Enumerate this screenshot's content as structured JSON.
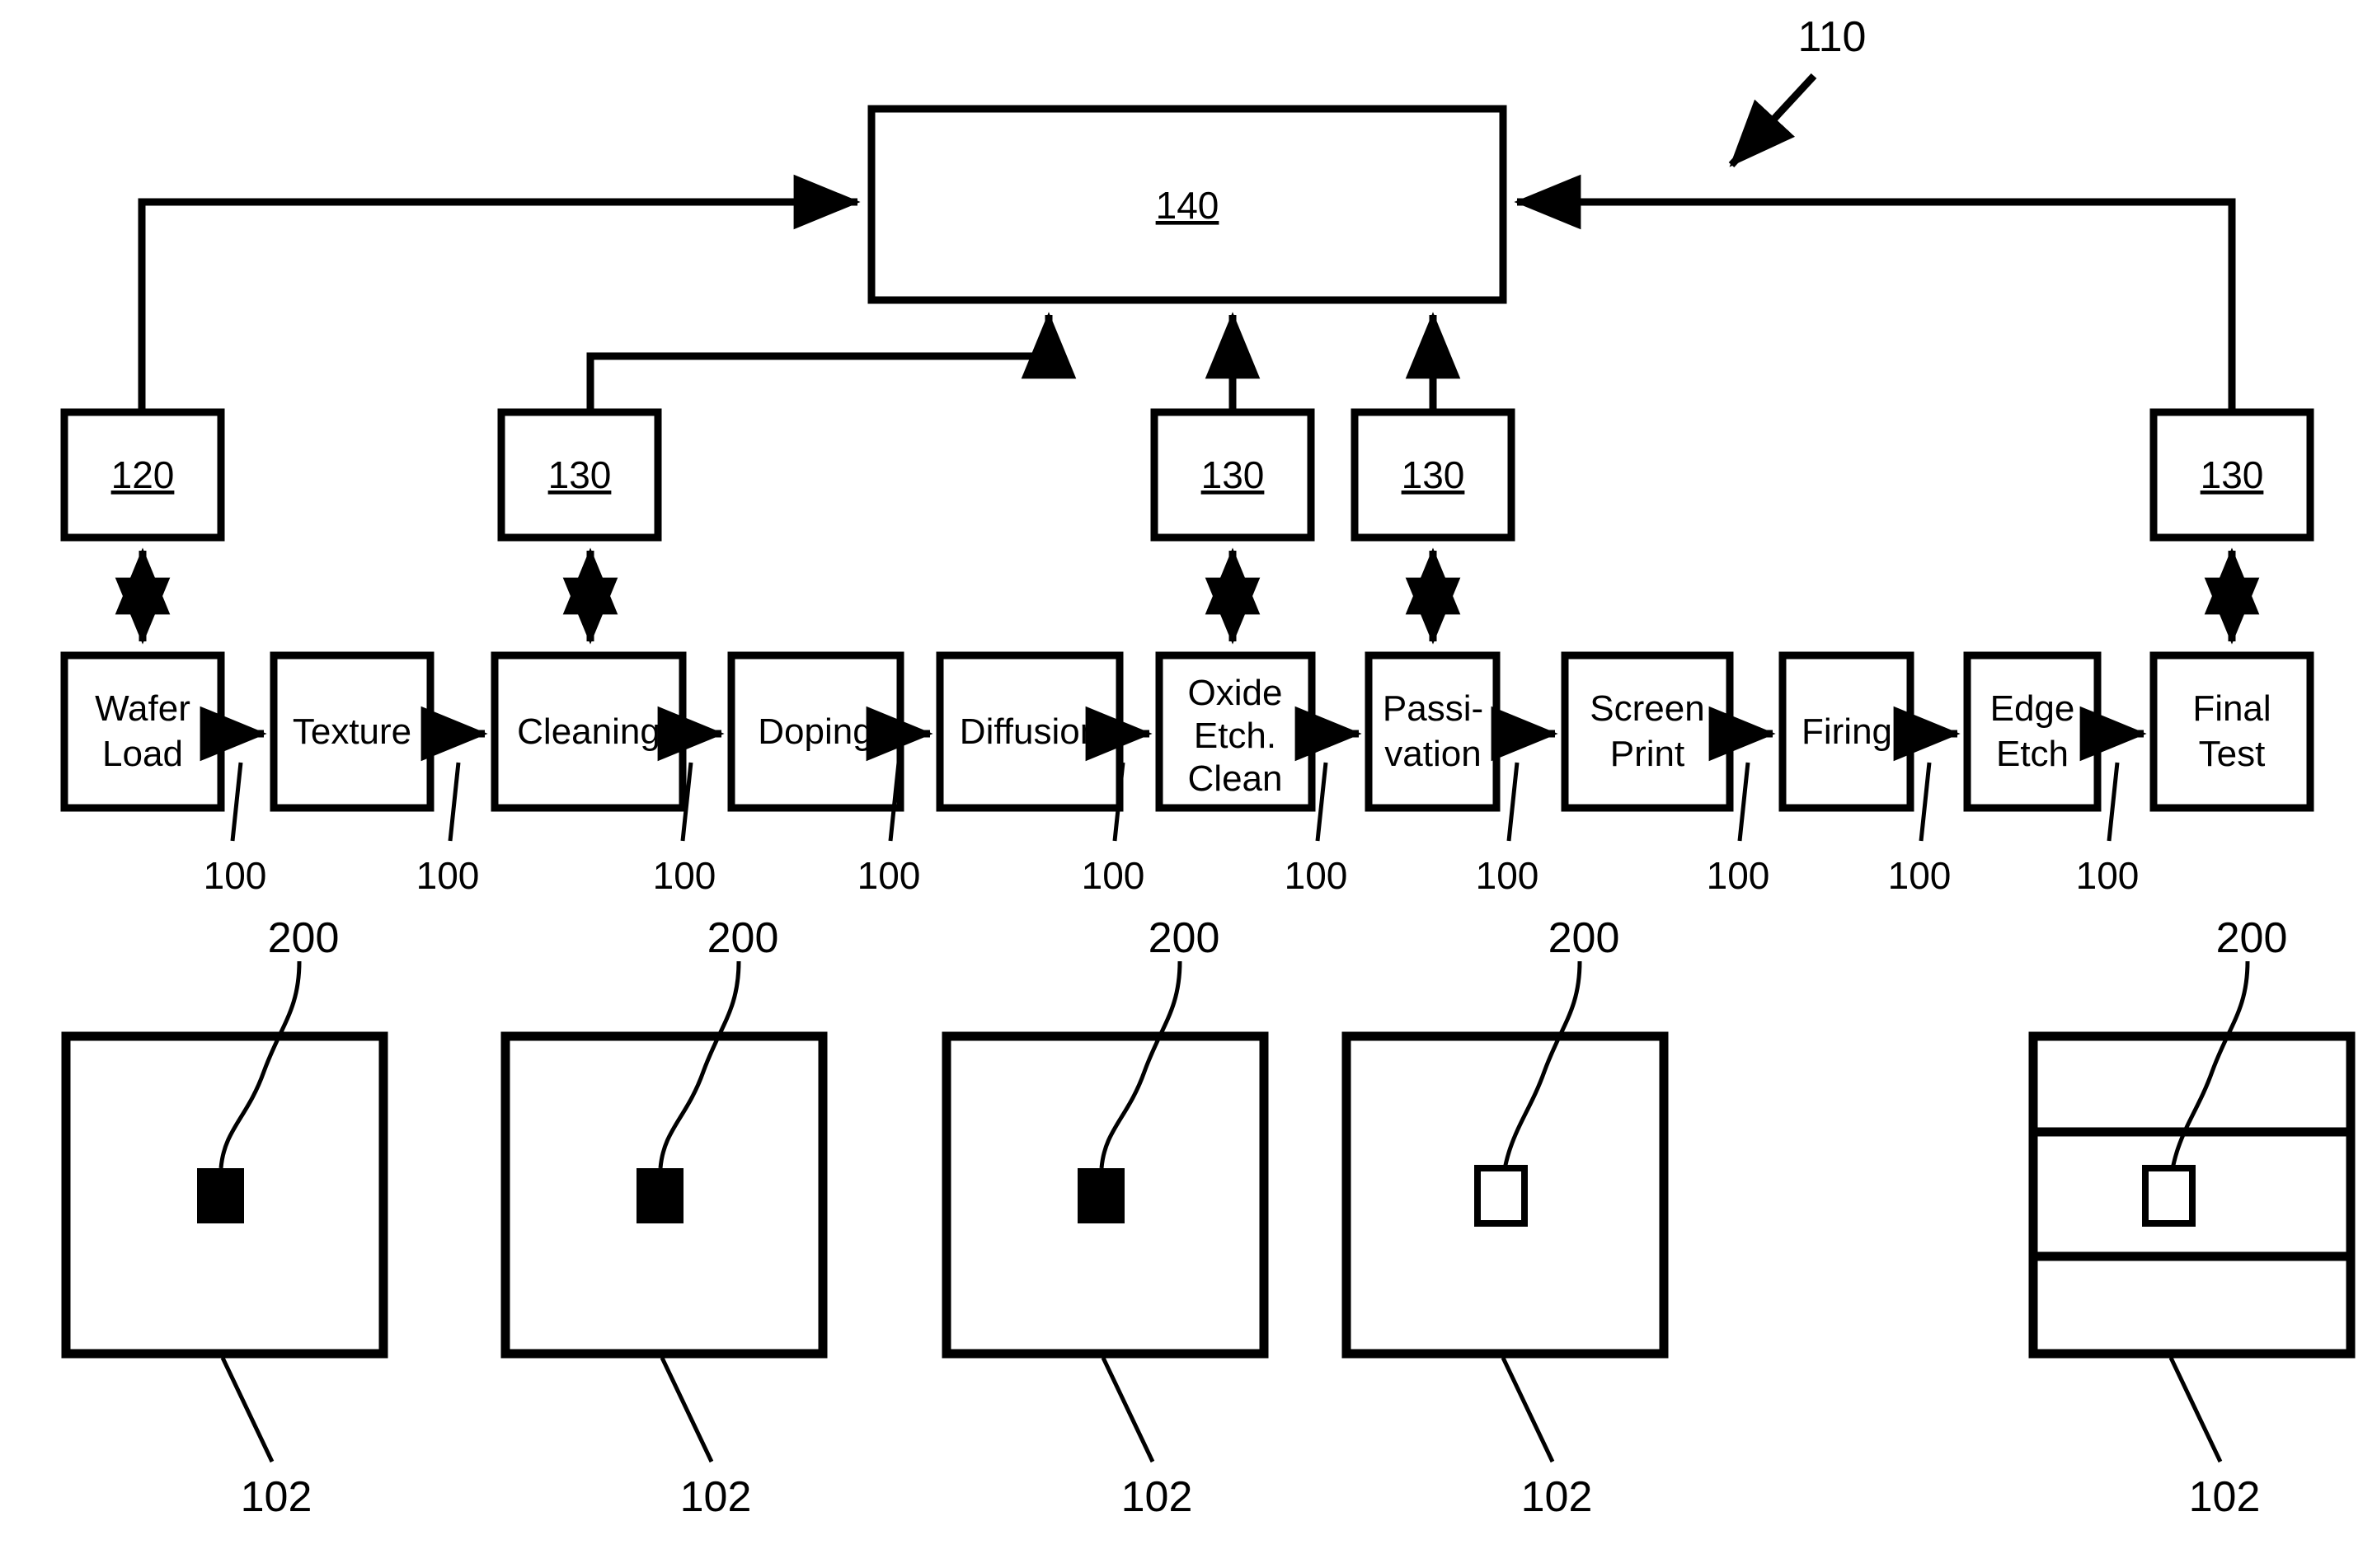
{
  "figure": {
    "title": "Solar cell manufacturing line process flow diagram",
    "stroke_color": "#000000",
    "background_color": "#ffffff"
  },
  "system_ref": {
    "label": "110",
    "description": "overall system reference arrow"
  },
  "controller": {
    "label": "140",
    "name": "central controller box"
  },
  "tool_boxes": [
    {
      "label": "120",
      "name": "wafer-load-tool"
    },
    {
      "label": "130",
      "name": "cleaning-tool"
    },
    {
      "label": "130",
      "name": "oxide-etch-clean-tool"
    },
    {
      "label": "130",
      "name": "passivation-tool"
    },
    {
      "label": "130",
      "name": "final-test-tool"
    }
  ],
  "process_steps": [
    {
      "lines": [
        "Wafer",
        "Load"
      ],
      "text": "Wafer Load"
    },
    {
      "lines": [
        "Texture"
      ],
      "text": "Texture"
    },
    {
      "lines": [
        "Cleaning"
      ],
      "text": "Cleaning"
    },
    {
      "lines": [
        "Doping"
      ],
      "text": "Doping"
    },
    {
      "lines": [
        "Diffusion"
      ],
      "text": "Diffusion"
    },
    {
      "lines": [
        "Oxide",
        "Etch.",
        "Clean"
      ],
      "text": "Oxide Etch. Clean"
    },
    {
      "lines": [
        "Passi-",
        "vation"
      ],
      "text": "Passi-vation"
    },
    {
      "lines": [
        "Screen",
        "Print"
      ],
      "text": "Screen Print"
    },
    {
      "lines": [
        "Firing"
      ],
      "text": "Firing"
    },
    {
      "lines": [
        "Edge",
        "Etch"
      ],
      "text": "Edge Etch"
    },
    {
      "lines": [
        "Final",
        "Test"
      ],
      "text": "Final Test"
    }
  ],
  "step_link_labels": [
    "100",
    "100",
    "100",
    "100",
    "100",
    "100",
    "100",
    "100",
    "100",
    "100"
  ],
  "wafers": [
    {
      "marker_label": "200",
      "wafer_label": "102",
      "marker_style": "filled",
      "divisions": 0
    },
    {
      "marker_label": "200",
      "wafer_label": "102",
      "marker_style": "filled",
      "divisions": 0
    },
    {
      "marker_label": "200",
      "wafer_label": "102",
      "marker_style": "filled",
      "divisions": 0
    },
    {
      "marker_label": "200",
      "wafer_label": "102",
      "marker_style": "open",
      "divisions": 0
    },
    {
      "marker_label": "200",
      "wafer_label": "102",
      "marker_style": "open",
      "divisions": 2
    }
  ]
}
